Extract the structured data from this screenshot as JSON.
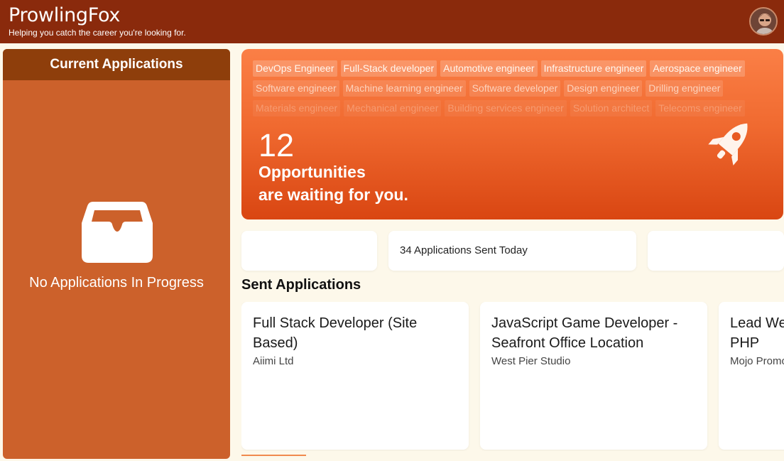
{
  "header": {
    "brand": "ProwlingFox",
    "tagline": "Helping you catch the career you're looking for."
  },
  "current_applications": {
    "title": "Current Applications",
    "empty_text": "No Applications In Progress"
  },
  "hero": {
    "tag_rows": [
      [
        "DevOps Engineer",
        "Full-Stack developer",
        "Automotive engineer",
        "Infrastructure engineer",
        "Aerospace engineer"
      ],
      [
        "Software engineer",
        "Machine learning engineer",
        "Software developer",
        "Design engineer",
        "Drilling engineer"
      ],
      [
        "Materials engineer",
        "Mechanical engineer",
        "Building services engineer",
        "Solution architect",
        "Telecoms engineer"
      ]
    ],
    "count": "12",
    "line1": "Opportunities",
    "line2": "are waiting for you."
  },
  "stats": {
    "applications_today": "34 Applications Sent Today"
  },
  "sent_applications": {
    "title": "Sent Applications",
    "cards": [
      {
        "title": "Full Stack Developer (Site Based)",
        "company": "Aiimi Ltd"
      },
      {
        "title": "JavaScript Game Developer - Seafront Office Location",
        "company": "West Pier Studio"
      },
      {
        "title": "Lead Web Developer - Laravel, PHP",
        "company": "Mojo Promotions"
      }
    ]
  },
  "colors": {
    "topbar": "#8a2a0c",
    "left_panel": "#cc612b",
    "left_header": "#8e3e0b",
    "hero_top": "#fb7f46",
    "hero_bottom": "#d94612",
    "background": "#fdf8ea"
  },
  "icons": {
    "empty_state": "inbox-tray-icon",
    "hero": "rocket-icon"
  }
}
